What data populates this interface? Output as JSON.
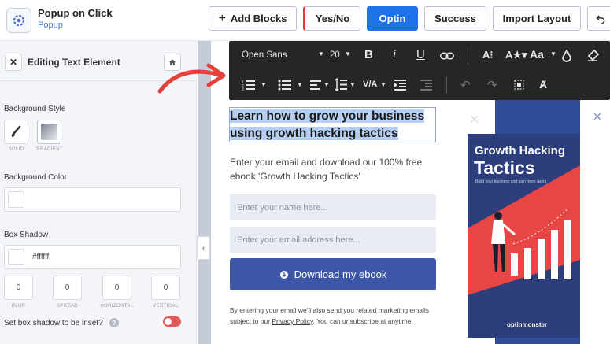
{
  "header": {
    "campaign_title": "Popup on Click",
    "campaign_type": "Popup",
    "add_blocks": "Add Blocks",
    "yesno": "Yes/No",
    "optin": "Optin",
    "success": "Success",
    "import_layout": "Import Layout"
  },
  "sidebar": {
    "title": "Editing Text Element",
    "background_style_label": "Background Style",
    "solid_label": "SOLID",
    "gradient_label": "GRADIENT",
    "background_color_label": "Background Color",
    "box_shadow_label": "Box Shadow",
    "box_shadow_value": "#ffffff",
    "blur_value": "0",
    "spread_value": "0",
    "horizontal_value": "0",
    "vertical_value": "0",
    "blur_label": "BLUR",
    "spread_label": "SPREAD",
    "horizontal_label": "HORIZONTAL",
    "vertical_label": "VERTICAL",
    "inset_label": "Set box shadow to be inset?",
    "inset_enabled": false
  },
  "toolbar": {
    "font_family": "Open Sans",
    "font_size": "20",
    "bold": "B",
    "italic": "i",
    "underline": "U",
    "case_label": "Aa",
    "va_label": "V/A"
  },
  "popup": {
    "headline_line1": "Learn how to grow your business",
    "headline_line2": "using growth hacking tactics",
    "subtext": "Enter your email and download our 100% free ebook 'Growth Hacking Tactics'",
    "name_placeholder": "Enter your name here...",
    "email_placeholder": "Enter your email address here...",
    "cta_label": "Download my ebook",
    "disclaimer_before": "By entering your email we'll also send you related marketing emails subject to our ",
    "disclaimer_link": "Privacy Policy",
    "disclaimer_after": ". You can unsubscribe at anytime."
  },
  "book": {
    "title_line1": "Growth Hacking",
    "title_line2": "Tactics",
    "subtitle": "Build your business and gain more users",
    "brand": "optinmonster"
  },
  "colors": {
    "accent_blue": "#1e73e8",
    "cta_blue": "#3d56a7",
    "book_navy": "#2c3f7c",
    "book_red": "#e84545",
    "annotation_red": "#e5403a",
    "toolbar_dark": "#262626"
  }
}
